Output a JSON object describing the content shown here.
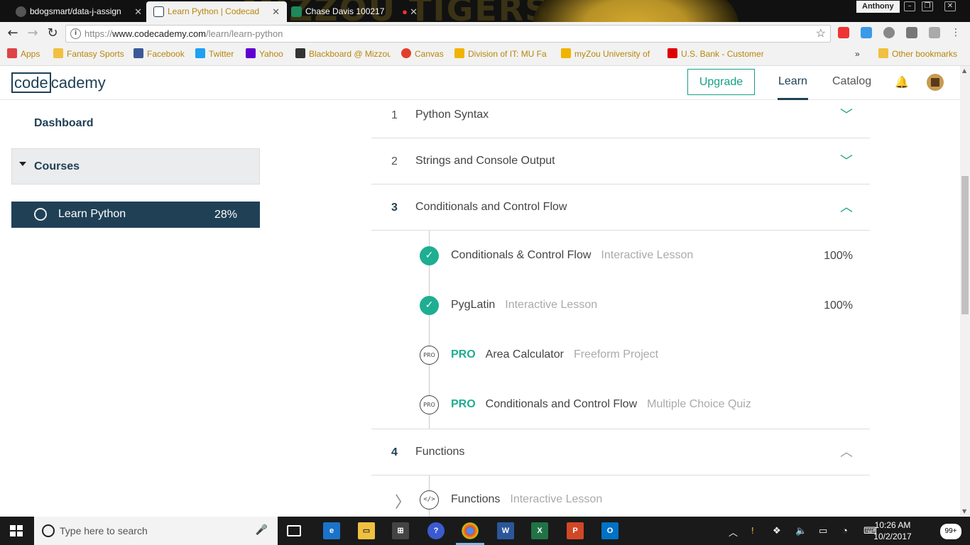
{
  "browser": {
    "tabs": [
      {
        "title": "bdogsmart/data-j-assign",
        "favicon_color": "#333"
      },
      {
        "title": "Learn Python | Codecad",
        "favicon_color": "#204056"
      },
      {
        "title": "Chase Davis 100217",
        "favicon_color": "#1e8a5a"
      }
    ],
    "profile_name": "Anthony",
    "window_controls": [
      "minimize",
      "maximize",
      "close"
    ],
    "url": {
      "scheme": "https://",
      "host": "www.codecademy.com",
      "path": "/learn/learn-python"
    },
    "bookmarks": [
      {
        "label": "Apps",
        "icon": "apps-grid-icon",
        "color": "#d44"
      },
      {
        "label": "Fantasy Sports",
        "icon": "folder-icon",
        "color": "#f0c040"
      },
      {
        "label": "Facebook",
        "icon": "facebook-icon",
        "color": "#3b5998"
      },
      {
        "label": "Twitter",
        "icon": "twitter-icon",
        "color": "#1da1f2"
      },
      {
        "label": "Yahoo",
        "icon": "yahoo-icon",
        "color": "#5f01d1"
      },
      {
        "label": "Blackboard @ Mizzou",
        "icon": "blackboard-icon",
        "color": "#333"
      },
      {
        "label": "Canvas",
        "icon": "canvas-icon",
        "color": "#e13f2b"
      },
      {
        "label": "Division of IT: MU Fa",
        "icon": "mu-icon",
        "color": "#f0b400"
      },
      {
        "label": "myZou University of",
        "icon": "mu-shield-icon",
        "color": "#f0b400"
      },
      {
        "label": "U.S. Bank - Customer",
        "icon": "usbank-icon",
        "color": "#d00"
      },
      {
        "label": "Other bookmarks",
        "icon": "folder-icon",
        "color": "#f0c040"
      }
    ],
    "bookmark_overflow": "»"
  },
  "header": {
    "logo_box": "code",
    "logo_rest": "cademy",
    "upgrade_label": "Upgrade",
    "nav_learn": "Learn",
    "nav_catalog": "Catalog"
  },
  "sidebar": {
    "dashboard": "Dashboard",
    "courses_label": "Courses",
    "course": {
      "name": "Learn Python",
      "progress": "28%"
    }
  },
  "syllabus": {
    "units": [
      {
        "number": "1",
        "title": "Python Syntax",
        "expanded": false
      },
      {
        "number": "2",
        "title": "Strings and Console Output",
        "expanded": false
      },
      {
        "number": "3",
        "title": "Conditionals and Control Flow",
        "expanded": true
      },
      {
        "number": "4",
        "title": "Functions",
        "expanded": true
      }
    ],
    "unit3_lessons": [
      {
        "pro": false,
        "title": "Conditionals & Control Flow",
        "kind": "Interactive Lesson",
        "progress": "100%",
        "status": "complete"
      },
      {
        "pro": false,
        "title": "PygLatin",
        "kind": "Interactive Lesson",
        "progress": "100%",
        "status": "complete"
      },
      {
        "pro": true,
        "pro_label": "PRO",
        "title": "Area Calculator",
        "kind": "Freeform Project",
        "status": "pro-badge"
      },
      {
        "pro": true,
        "pro_label": "PRO",
        "title": "Conditionals and Control Flow",
        "kind": "Multiple Choice Quiz",
        "status": "pro-badge"
      }
    ],
    "status_badge_text": "PRO",
    "unit4_lessons": [
      {
        "title": "Functions",
        "kind": "Interactive Lesson",
        "status": "code-icon",
        "icon_text": "</>"
      }
    ]
  },
  "taskbar": {
    "search_placeholder": "Type here to search",
    "time": "10:26 AM",
    "date": "10/2/2017",
    "notifications": "99+",
    "apps": [
      "task-view-icon",
      "edge-icon",
      "file-explorer-icon",
      "store-icon",
      "help-icon",
      "chrome-icon",
      "word-icon",
      "excel-icon",
      "powerpoint-icon",
      "outlook-icon"
    ]
  },
  "colors": {
    "brand": "#204056",
    "accent": "#1eae91",
    "sidebar_active_bg": "#204056"
  }
}
